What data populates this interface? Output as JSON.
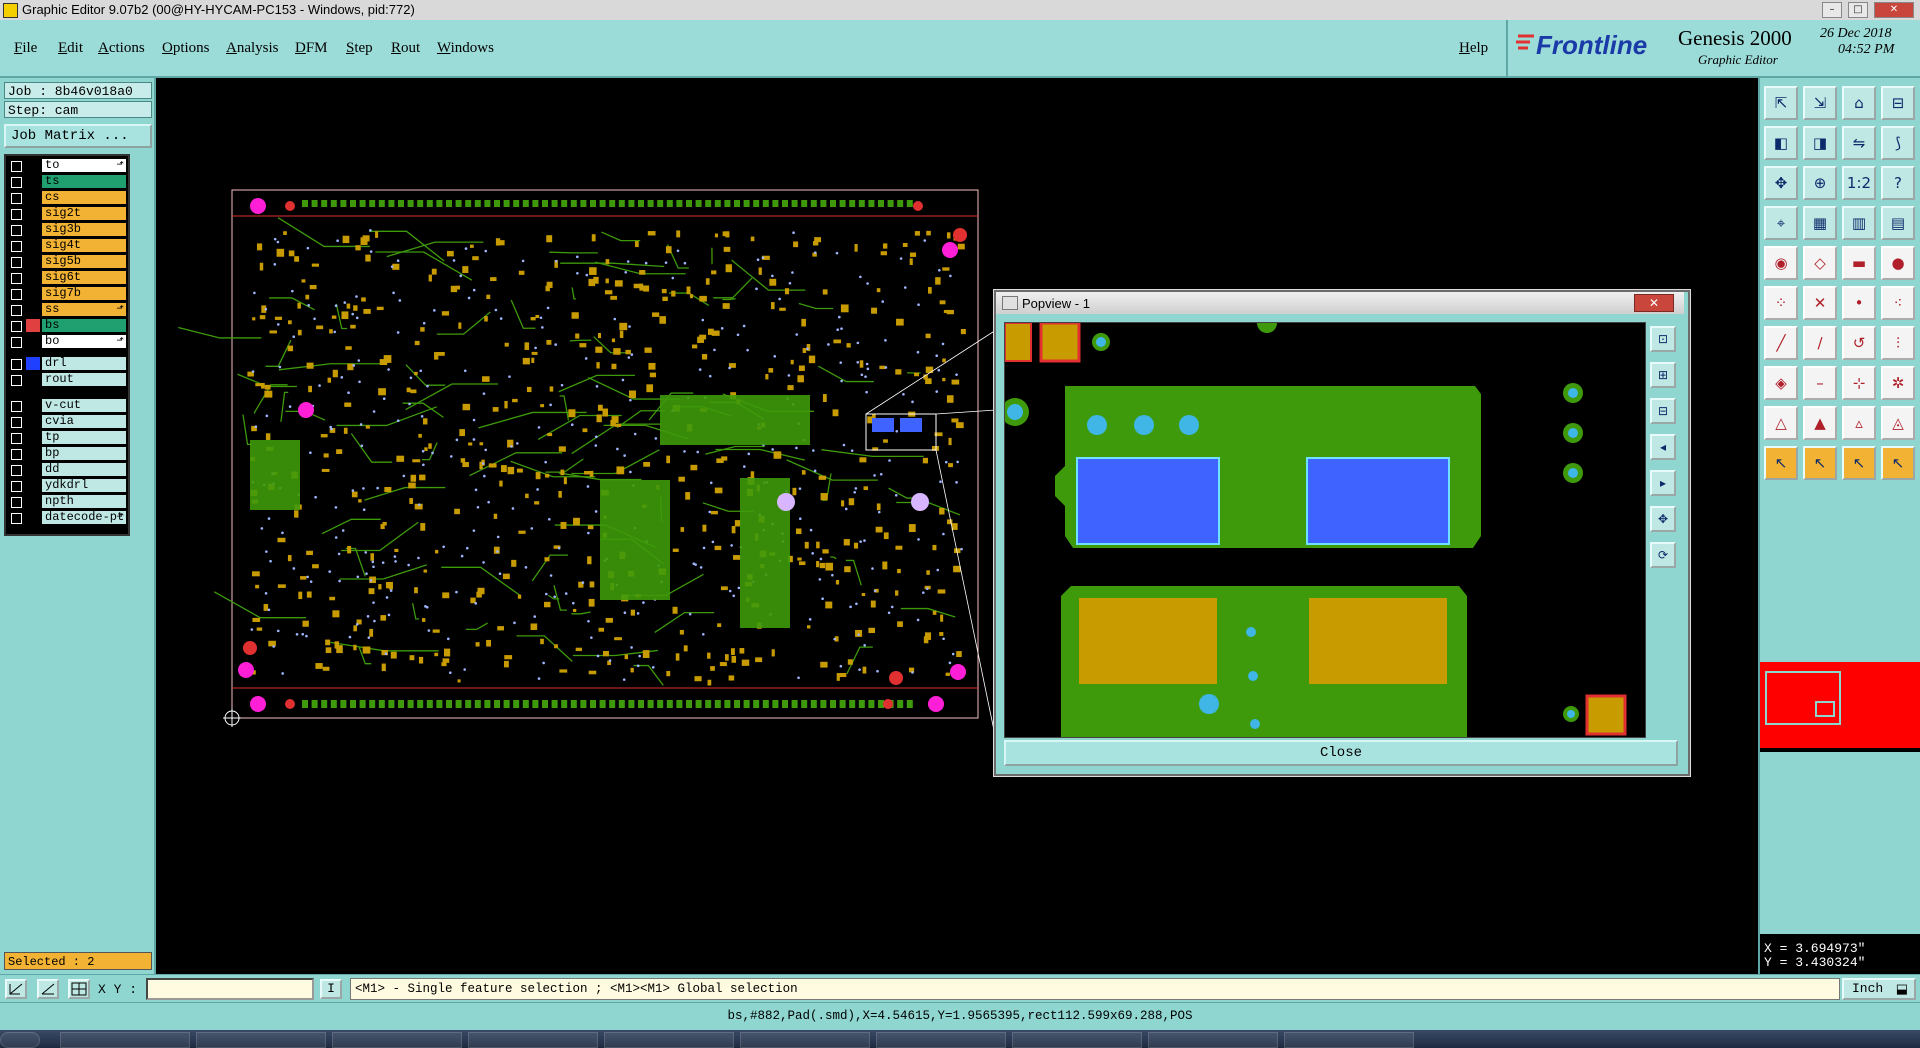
{
  "window": {
    "title": "Graphic Editor 9.07b2 (00@HY-HYCAM-PC153 - Windows, pid:772)",
    "controls": [
      "–",
      "□",
      "✕"
    ]
  },
  "menu": {
    "items": [
      "File",
      "Edit",
      "Actions",
      "Options",
      "Analysis",
      "DFM",
      "Step",
      "Rout",
      "Windows"
    ],
    "help": "Help"
  },
  "brand": {
    "logo": "Frontline",
    "product": "Genesis 2000",
    "subtitle": "Graphic Editor",
    "date": "26 Dec 2018",
    "time": "04:52 PM"
  },
  "job": {
    "job_line": "Job : 8b46v018a0",
    "step_line": "Step: cam",
    "matrix_button": "Job Matrix ..."
  },
  "layers": [
    {
      "name": "to",
      "color": "#ffffff",
      "swatch": "#000000",
      "mark": "⬏"
    },
    {
      "name": "ts",
      "color": "#20a070",
      "swatch": "#000000",
      "mark": ""
    },
    {
      "name": "cs",
      "color": "#f2b233",
      "swatch": "#000000",
      "mark": ""
    },
    {
      "name": "sig2t",
      "color": "#f2b233",
      "swatch": "#000000",
      "mark": ""
    },
    {
      "name": "sig3b",
      "color": "#f2b233",
      "swatch": "#000000",
      "mark": ""
    },
    {
      "name": "sig4t",
      "color": "#f2b233",
      "swatch": "#000000",
      "mark": ""
    },
    {
      "name": "sig5b",
      "color": "#f2b233",
      "swatch": "#000000",
      "mark": ""
    },
    {
      "name": "sig6t",
      "color": "#f2b233",
      "swatch": "#000000",
      "mark": ""
    },
    {
      "name": "sig7b",
      "color": "#f2b233",
      "swatch": "#000000",
      "mark": ""
    },
    {
      "name": "ss",
      "color": "#f2b233",
      "swatch": "#000000",
      "mark": "⬏"
    },
    {
      "name": "bs",
      "color": "#20a070",
      "swatch": "#e04040",
      "mark": ""
    },
    {
      "name": "bo",
      "color": "#ffffff",
      "swatch": "#000000",
      "mark": "⬏"
    },
    {
      "name": "drl",
      "color": "#bfe8e5",
      "swatch": "#2040ff",
      "mark": ""
    },
    {
      "name": "rout",
      "color": "#bfe8e5",
      "swatch": "#000000",
      "mark": ""
    },
    {
      "name": "v-cut",
      "color": "#bfe8e5",
      "swatch": "#000000",
      "mark": ""
    },
    {
      "name": "cvia",
      "color": "#bfe8e5",
      "swatch": "#000000",
      "mark": ""
    },
    {
      "name": "tp",
      "color": "#bfe8e5",
      "swatch": "#000000",
      "mark": ""
    },
    {
      "name": "bp",
      "color": "#bfe8e5",
      "swatch": "#000000",
      "mark": ""
    },
    {
      "name": "dd",
      "color": "#bfe8e5",
      "swatch": "#000000",
      "mark": ""
    },
    {
      "name": "ydkdrl",
      "color": "#bfe8e5",
      "swatch": "#000000",
      "mark": ""
    },
    {
      "name": "npth",
      "color": "#bfe8e5",
      "swatch": "#000000",
      "mark": ""
    },
    {
      "name": "datecode-pt",
      "color": "#bfe8e5",
      "swatch": "#000000",
      "mark": "⬏"
    }
  ],
  "selected_text": "Selected : 2",
  "popview": {
    "title": "Popview - 1",
    "close_label": "Close",
    "close_x": "✕"
  },
  "coords": {
    "x": "X = 3.694973\"",
    "y": "Y = 3.430324\""
  },
  "command": {
    "xy_label": "X Y :",
    "xy_value": "",
    "info_glyph": "I",
    "hint": "<M1> - Single feature selection ; <M1><M1> Global selection",
    "unit": "Inch"
  },
  "status_line": "bs,#882,Pad(.smd),X=4.54615,Y=1.9565395,rect112.599x69.288,POS",
  "colors": {
    "panel": "#8fd6d1",
    "copper_green": "#3e9a0a",
    "pad_orange": "#c89b00",
    "via_blue": "#3fb6e6",
    "smd_blue": "#3f63ff",
    "hole_magenta": "#ff1fd6",
    "outline_red": "#e03030"
  },
  "icons": {
    "tools": [
      "pan-icon",
      "zoom-in-icon",
      "home-icon",
      "split-icon",
      "left-icon",
      "right-icon",
      "mirror-icon",
      "snake-icon",
      "fit-icon",
      "center-icon",
      "ratio-icon",
      "help-icon",
      "snap-icon",
      "grid-icon",
      "layer-icon",
      "layers-icon",
      "pad-icon",
      "poly-icon",
      "measure-icon",
      "circle-icon",
      "node-icon",
      "cross-icon",
      "dot-icon",
      "dots-icon",
      "line-icon",
      "slash-icon",
      "arc-icon",
      "split-line-icon",
      "shape-icon",
      "minus-icon",
      "pin-icon",
      "star-icon",
      "text-a-icon",
      "text-b-icon",
      "text-c-icon",
      "text-d-icon",
      "select-icon",
      "select-2-icon",
      "select-3-icon",
      "select-4-icon"
    ]
  }
}
